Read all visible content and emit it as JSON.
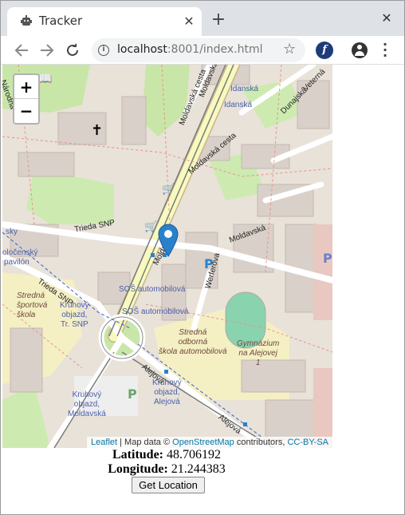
{
  "browser": {
    "tab_title": "Tracker",
    "tab_close": "✕",
    "new_tab": "+",
    "window_close": "✕",
    "url_host": "localhost",
    "url_rest": ":8001/index.html",
    "ext_letter": "f"
  },
  "map": {
    "zoom_in": "+",
    "zoom_out": "−",
    "attribution": {
      "leaflet": "Leaflet",
      "sep1": " | Map data © ",
      "osm": "OpenStreetMap",
      "contributors": " contributors, ",
      "license": "CC-BY-SA"
    },
    "labels": {
      "idanska1": "Idanská",
      "idanska2": "Idanská",
      "dunajska": "Dunajská",
      "veterna": "Veterná",
      "moldavska_cesta1": "Moldavská cesta",
      "moldavska_cesta2": "Moldavská cesta",
      "moldavska1": "Moldavská",
      "moldavska2": "Moldavská",
      "moldavska3": "Moldavská",
      "trieda_snp1": "Trieda SNP",
      "trieda_snp2": "Trieda SNP",
      "werferova": "Werferova",
      "sos1": "SOŠ automobilová",
      "sos2": "SOŠ automobilová",
      "stredna_sportova": [
        "Stredná",
        "športová",
        "škola"
      ],
      "kruhovy_snp": [
        "Kruhový",
        "objazd,",
        "Tr. SNP"
      ],
      "stredna_odborna": [
        "Stredná",
        "odborná",
        "škola automobilová"
      ],
      "gymnazium": [
        "Gymnázium",
        "na Alejovej",
        "1"
      ],
      "aleja1": "Alejová",
      "aleja2": "Alejová",
      "kruhovy_alejova": [
        "Kruhový",
        "objazd,",
        "Alejová"
      ],
      "kruhovy_moldavska": [
        "Kruhový",
        "objazd,",
        "Moldavská"
      ],
      "sky": "sky",
      "polocensky": "oločenský",
      "pavilon": "pavilón",
      "narodna": "Národná"
    }
  },
  "location": {
    "latitude_label": "Latitude:",
    "latitude_value": " 48.706192",
    "longitude_label": "Longitude:",
    "longitude_value": " 21.244383",
    "button_label": "Get Location"
  },
  "colors": {
    "map_bg": "#e8e2d8",
    "park_green": "#c8e6a8",
    "building": "#d9d0c9",
    "road_white": "#ffffff",
    "road_yellow": "#f7f9be",
    "track": "#7a7a7a",
    "marker_blue": "#2a81cb",
    "pitch_green": "#8ad3af",
    "label_blue": "#4a5fa8"
  }
}
